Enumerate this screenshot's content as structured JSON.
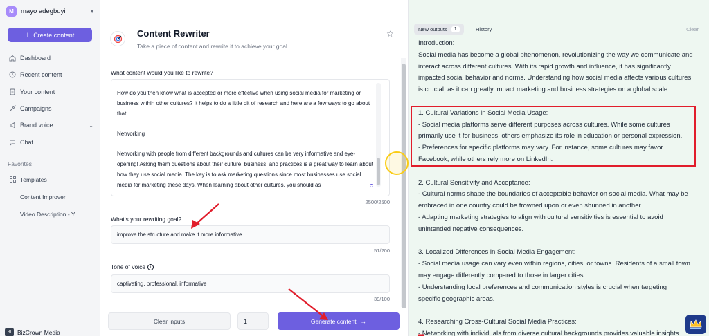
{
  "sidebar": {
    "user_initial": "M",
    "user_name": "mayo adegbuyi",
    "create_label": "Create content",
    "nav": [
      {
        "label": "Dashboard"
      },
      {
        "label": "Recent content"
      },
      {
        "label": "Your content"
      },
      {
        "label": "Campaigns"
      },
      {
        "label": "Brand voice"
      },
      {
        "label": "Chat"
      }
    ],
    "favorites_title": "Favorites",
    "favorites": [
      {
        "label": "Templates"
      },
      {
        "label": "Content Improver"
      },
      {
        "label": "Video Description - Y..."
      }
    ],
    "brand_initials": "BI",
    "brand_name": "BizCrown Media"
  },
  "tool": {
    "title": "Content Rewriter",
    "subtitle": "Take a piece of content and rewrite it to achieve your goal.",
    "content_label": "What content would you like to rewrite?",
    "content_paragraphs": [
      "How do you then know what is accepted or more effective when using social media for marketing or business within other cultures? It helps to do a little bit of research and here are a few ways to go about that.",
      "Networking",
      "Networking with people from different backgrounds and cultures can be very informative and eye-opening! Asking them questions about their culture, business, and practices is a great way to learn about how they use social media. The key is to ask marketing questions since most businesses use social media for marketing these days. When learning about other cultures, you should as"
    ],
    "content_counter": "2500/2500",
    "goal_label": "What's your rewriting goal?",
    "goal_value": "improve the structure and make it more informative",
    "goal_counter": "51/200",
    "tone_label": "Tone of voice",
    "tone_value": "captivating, professional, informative",
    "tone_counter": "39/100",
    "clear_label": "Clear inputs",
    "count_value": "1",
    "generate_label": "Generate content",
    "generate_arrow": "→"
  },
  "outputs": {
    "new_tab": "New outputs",
    "new_count": "1",
    "history_tab": "History",
    "clear": "Clear",
    "lines": [
      "Introduction:",
      "Social media has become a global phenomenon, revolutionizing the way we communicate and",
      "interact across different cultures. With its rapid growth and influence, it has significantly",
      "impacted social behavior and norms. Understanding how social media affects various cultures",
      "is crucial, as it can greatly impact marketing and business strategies on a global scale.",
      "",
      "1. Cultural Variations in Social Media Usage:",
      "- Social media platforms serve different purposes across cultures. While some cultures",
      "primarily use it for business, others emphasize its role in education or personal expression.",
      "- Preferences for specific platforms may vary. For instance, some cultures may favor",
      "Facebook, while others rely more on LinkedIn.",
      "",
      "2. Cultural Sensitivity and Acceptance:",
      "- Cultural norms shape the boundaries of acceptable behavior on social media. What may be",
      "embraced in one country could be frowned upon or even shunned in another.",
      "- Adapting marketing strategies to align with cultural sensitivities is essential to avoid",
      "unintended negative consequences.",
      "",
      "3. Localized Differences in Social Media Engagement:",
      "- Social media usage can vary even within regions, cities, or towns. Residents of a small town",
      "may engage differently compared to those in larger cities.",
      "- Understanding local preferences and communication styles is crucial when targeting",
      "specific geographic areas.",
      "",
      "4. Researching Cross-Cultural Social Media Practices:",
      "- Networking with individuals from diverse cultural backgrounds provides valuable insights"
    ]
  },
  "colors": {
    "accent": "#6d5fe0",
    "highlight_box": "#e11d2b",
    "output_bg": "#eef7f1",
    "annotation_arrow": "#e11d2b"
  }
}
